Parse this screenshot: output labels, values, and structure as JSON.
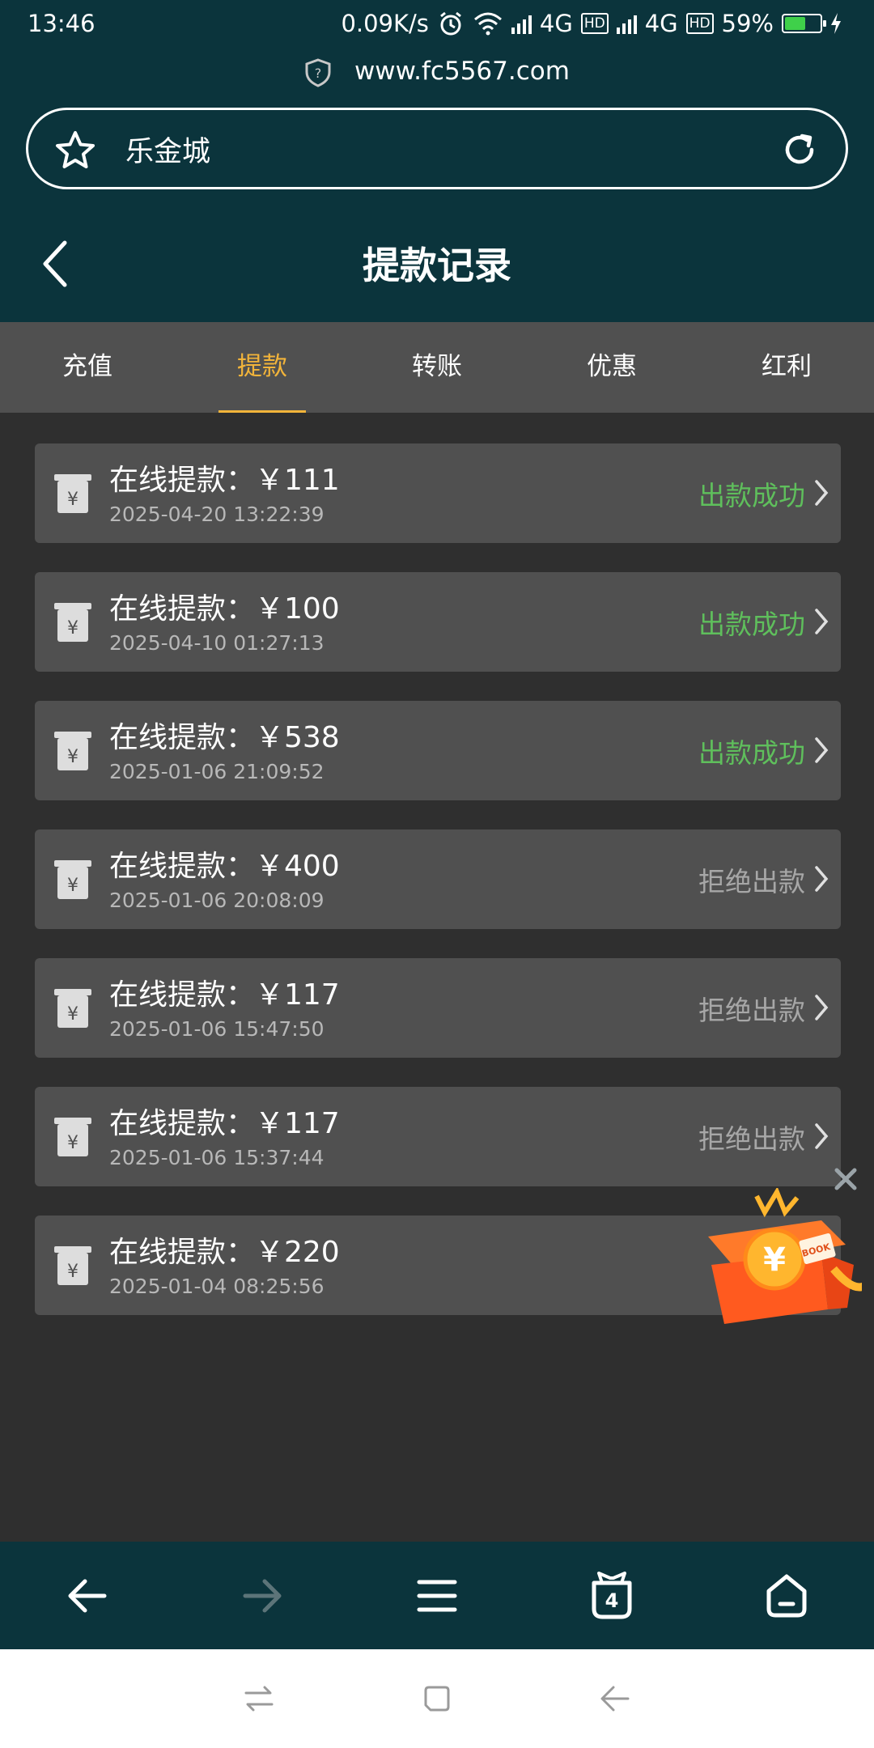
{
  "status_bar": {
    "time": "13:46",
    "speed": "0.09K/s",
    "net1": "4G",
    "net2": "4G",
    "hd": "HD",
    "battery": "59%",
    "battery_level": 0.59
  },
  "browser": {
    "url": "www.fc5567.com",
    "site_title": "乐金城",
    "tab_count": "4"
  },
  "page": {
    "title": "提款记录"
  },
  "tabs": [
    {
      "label": "充值",
      "active": false
    },
    {
      "label": "提款",
      "active": true
    },
    {
      "label": "转账",
      "active": false
    },
    {
      "label": "优惠",
      "active": false
    },
    {
      "label": "红利",
      "active": false
    }
  ],
  "records": [
    {
      "title": "在线提款：￥111",
      "time": "2025-04-20 13:22:39",
      "status": "出款成功",
      "ok": true
    },
    {
      "title": "在线提款：￥100",
      "time": "2025-04-10 01:27:13",
      "status": "出款成功",
      "ok": true
    },
    {
      "title": "在线提款：￥538",
      "time": "2025-01-06 21:09:52",
      "status": "出款成功",
      "ok": true
    },
    {
      "title": "在线提款：￥400",
      "time": "2025-01-06 20:08:09",
      "status": "拒绝出款",
      "ok": false
    },
    {
      "title": "在线提款：￥117",
      "time": "2025-01-06 15:47:50",
      "status": "拒绝出款",
      "ok": false
    },
    {
      "title": "在线提款：￥117",
      "time": "2025-01-06 15:37:44",
      "status": "拒绝出款",
      "ok": false
    },
    {
      "title": "在线提款：￥220",
      "time": "2025-01-04 08:25:56",
      "status": "",
      "ok": true
    }
  ],
  "colors": {
    "header_bg": "#0b343c",
    "tab_active": "#f2b43a",
    "status_ok": "#5fbf5c",
    "status_rejected": "#a7a7a7"
  },
  "promo": {
    "badge_text": "BOOK",
    "coin_symbol": "¥"
  }
}
